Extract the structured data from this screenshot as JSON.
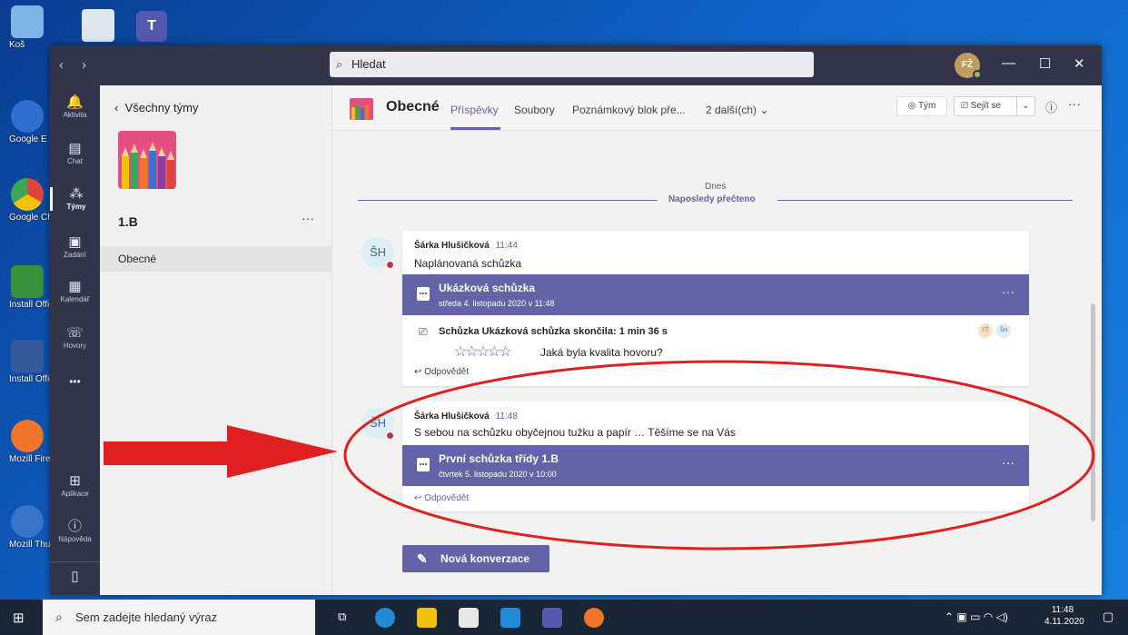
{
  "desktop": {
    "icons": [
      {
        "label": "Koš",
        "color": "#7fb4e6"
      },
      {
        "label": "Google E",
        "color": "#2f6fd1"
      },
      {
        "label": "Google Chrome",
        "color": "#e0453a"
      },
      {
        "label": "Install Office N",
        "color": "#3a8f3a"
      },
      {
        "label": "Install Office N",
        "color": "#355a9c"
      },
      {
        "label": "Mozill Firefo",
        "color": "#f0742a"
      },
      {
        "label": "Mozill Thunderi",
        "color": "#3875c8"
      }
    ]
  },
  "titlebar": {
    "search_placeholder": "Hledat",
    "avatar_initials": "FŽ"
  },
  "rail": {
    "items": [
      {
        "label": "Aktivita",
        "icon": "bell-icon",
        "glyph": "🔔"
      },
      {
        "label": "Chat",
        "icon": "chat-icon",
        "glyph": "▤"
      },
      {
        "label": "Týmy",
        "icon": "teams-icon",
        "glyph": "⁂"
      },
      {
        "label": "Zadání",
        "icon": "assignment-icon",
        "glyph": "▣"
      },
      {
        "label": "Kalendář",
        "icon": "calendar-icon",
        "glyph": "▦"
      },
      {
        "label": "Hovory",
        "icon": "phone-icon",
        "glyph": "☏"
      },
      {
        "label": "",
        "icon": "more-icon",
        "glyph": "•••"
      },
      {
        "label": "Aplikace",
        "icon": "apps-icon",
        "glyph": "⊞"
      },
      {
        "label": "Nápověda",
        "icon": "help-icon",
        "glyph": "?"
      }
    ]
  },
  "teampanel": {
    "back_label": "Všechny týmy",
    "team_name": "1.B",
    "channel": "Obecné"
  },
  "channel_header": {
    "title": "Obecné",
    "tabs": [
      "Příspěvky",
      "Soubory",
      "Poznámkový blok pře...",
      "2 další(ch)"
    ],
    "team_button": "Tým",
    "meet_button": "Sejít se"
  },
  "feed": {
    "divider_date": "Dnes",
    "last_read": "Naposledy přečteno",
    "posts": [
      {
        "avatar": "ŠH",
        "author": "Šárka Hlušičková",
        "time": "11:44",
        "text": "Naplánovaná schůzka",
        "meeting_title": "Ukázková schůzka",
        "meeting_date": "středa 4. listopadu 2020 v 11:48",
        "ended_text": "Schůzka Ukázková schůzka skončila: 1 min 36 s",
        "rating_question": "Jaká byla kvalita hovoru?",
        "participants": [
          "FŽ",
          "ŠH"
        ],
        "reply": "Odpovědět"
      },
      {
        "avatar": "ŠH",
        "author": "Šárka Hlušičková",
        "time": "11:48",
        "text": "S sebou na schůzku obyčejnou tužku a papír … Těšíme se na Vás",
        "meeting_title": "První schůzka třídy 1.B",
        "meeting_date": "čtvrtek 5. listopadu 2020 v 10:00",
        "reply": "Odpovědět"
      }
    ],
    "new_conversation": "Nová konverzace"
  },
  "taskbar": {
    "search_placeholder": "Sem zadejte hledaný výraz",
    "time": "11:48",
    "date": "4.11.2020"
  },
  "colors": {
    "accent": "#6264a7",
    "rail": "#33344a",
    "annotation": "#e02020"
  }
}
